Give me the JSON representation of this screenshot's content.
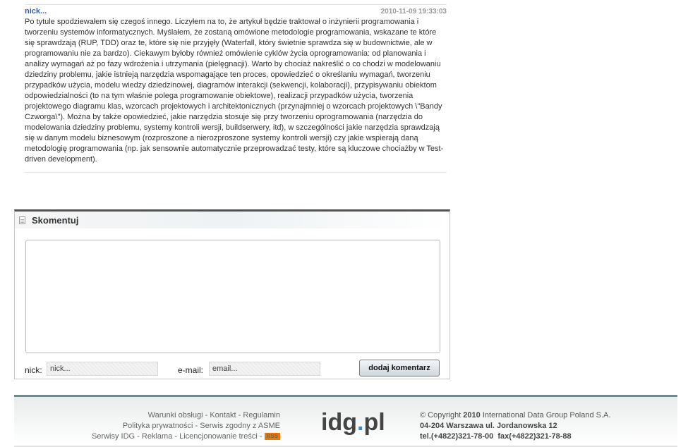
{
  "comment": {
    "author": "nick...",
    "date": "2010-11-09 19:33:03",
    "text": "Po tytule spodziewałem się czegoś innego. Liczyłem na to, że artykuł będzie traktował o inżynierii programowania i tworzeniu systemów informatycznych. Myślałem, że zostaną omówione metodologie programowania, wskazane te które się sprawdzają (RUP, TDD) oraz te, które się nie przyjęły (Waterfall, który świetnie sprawdza się w budownictwie, ale w programowaniu nie za bardzo). Ciekawym byłoby również omówienie cyklów życia oprogramowania: od planowania i analizy wymagań aż po fazy wdrożenia i utrzymania (pielęgnacji). Warto by chociaż nakreślić o co chodzi w modelowaniu dziedziny problemu, jakie istnieją narzędzia wspomagające ten proces, opowiedzieć o określaniu wymagań, tworzeniu przypadków użycia, modelu wiedzy dziedzinowej, diagramów interakcji (sekwencji, kolaboracji), przypisywaniu obiektom odpowiedzialności (to na tym właśnie polega programowanie obiektowe), realizacji przypadków użycia, tworzenia projektowego diagramu klas, wzorcach projektowych i architektonicznych (przynajmniej o wzorcach projektowych \\\"Bandy Czworga\\\"). Można by także opowiedzieć, jakie narzędzia stosuje się przy tworzeniu oprogramowania (narzędzia do modelowania dziedziny problemu, systemy kontroli wersji, buildserwery, itd), w szczególności jakie narzędzia sprawdzają się w danym modelu biznesowym (rozproszone a nierozproszone systemy kontroli wersji) czy jakie wspierają daną metodologię programowania (np. jak sensownie automatycznie przeprowadzać testy, które są kluczowe chociażby w Test-driven development)."
  },
  "comment_form": {
    "title": "Skomentuj",
    "textarea_value": "",
    "nick_label": "nick:",
    "nick_value": "nick...",
    "email_label": "e-mail:",
    "email_value": "email...",
    "submit_label": "dodaj komentarz"
  },
  "footer": {
    "links": {
      "terms": "Warunki obsługi",
      "contact": "Kontakt",
      "rules": "Regulamin",
      "privacy": "Polityka prywatności",
      "asme": "Serwis zgodny z ASME",
      "idg_services": "Serwisy IDG",
      "ads": "Reklama",
      "licensing": "Licencjonowanie treści",
      "rss": "RSS"
    },
    "separator": " - ",
    "logo_prefix": "idg",
    "logo_dot": ".",
    "logo_suffix": "pl",
    "copyright_prefix": "© Copyright ",
    "copyright_year": "2010",
    "copyright_company": " International Data Group Poland S.A.",
    "address": "04-204 Warszawa ul. Jordanowska 12",
    "phone": "tel.(+4822)321-78-00",
    "fax": "fax(+4822)321-78-88"
  },
  "colors": {
    "author_link": "#3a5fb0",
    "form_top_border": "#505050",
    "footer_border": "#6f8a88",
    "logo_dot": "#2f8fd0",
    "rss_badge": "#f07800"
  }
}
